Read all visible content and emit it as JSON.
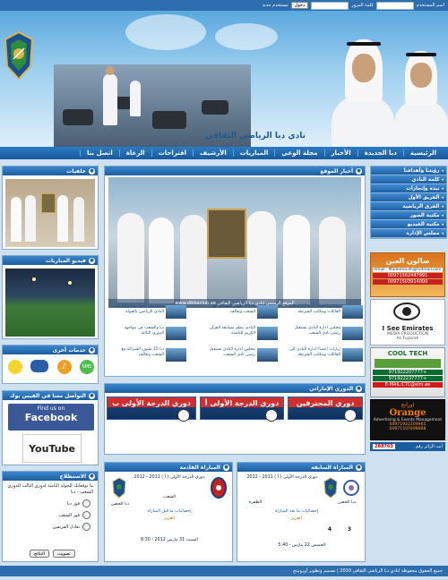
{
  "topbar": {
    "username_label": "اسم المستخدم",
    "password_label": "كلمة المرور",
    "login_button": "دخول",
    "register_link": "مستخدم جديد"
  },
  "header": {
    "site_title": "نادي دبا الرياضي الثقافي"
  },
  "mainnav": {
    "items": [
      "الرئيسية",
      "دبا الجديدة",
      "الأخبار",
      "مجلة الوعي",
      "المباريات",
      "الأرشيف",
      "اقتراحات",
      "الرعاة",
      "اتصل بنا"
    ]
  },
  "rightnav": {
    "items": [
      "رؤيتنا وأهدافنا",
      "كلمة النادي",
      "نبذة وإنجازات",
      "الفريق الأول",
      "الفرق الرياضية",
      "مكتبة الصور",
      "مكتبة الفيديو",
      "مجلس الإدارة"
    ]
  },
  "ads": {
    "ad1_title": "صالون العين",
    "ad1_email": "email : Madeena.eh@hotmail.com",
    "ad1_phone1": "00971562447991",
    "ad1_phone2": "00971503914000",
    "ad2_title": "I See Emirates",
    "ad2_sub": "MEDIA PRODUCTION",
    "ad2_city": "AL Fujairah",
    "ad3_title": "COOL TECH",
    "ad3_phone1": "+971922207777",
    "ad3_phone2": "+971922237777",
    "ad3_email": "E-MAIL:CTC@elm.ae",
    "ad4_arabic": "اورانج",
    "ad4_title": "Orange",
    "ad4_sub": "Advertising & Events Management",
    "ad4_phone1": "00971922209965",
    "ad4_phone2": "00971507898888"
  },
  "visitors": {
    "label": "أنت الزائر رقم",
    "count": "288763"
  },
  "panels": {
    "backgrounds_title": "خلفيات",
    "stadium_title": "فيديو المباريات",
    "services_title": "خدمات أخرى",
    "social_title": "التواصل معنا في الفيس بوك",
    "facebook_find": "Find us on",
    "facebook_name": "Facebook",
    "youtube_name": "YouTube",
    "poll_title": "الاستطلاع",
    "poll_question": "ما توقعاتك للجولة الثامنة لدوري الثالث للدوري الشعب - دبا",
    "poll_options": [
      "فوز دبا",
      "فوز الشعب",
      "تعادل الفريقين"
    ],
    "poll_vote": "تصويت",
    "poll_results": "النتائج",
    "news_title": "أخبار الموقع",
    "photo_caption": "الموقع الرسمي لنادي دبا الرياضي الثقافي   www.dibbaclub.ae",
    "league_title": "الدوري الإماراتي",
    "next_match_title": "المباراة القادمة",
    "prev_match_title": "المباراة السابقة"
  },
  "news": [
    "زيارات أعضاء ادارة النادي الى العائلات ومكاتب الشرطة",
    "دبا 15 مليون الشراكة مع الشعب وتعالف",
    "سمو ولي العهد ينوه بإنجازات النادي الرياضي بالجولة",
    "مجلس ادارة النادي يستقبل رئيس نادي الشعب",
    "النادي ينظم مسابقة القرآن الكريم للناشئة",
    "دبا والشعب في مواجهة الدوري الثالثة"
  ],
  "leagues": [
    "دوري المحترفين",
    "دوري الدرجة الأولى أ",
    "دوري الدرجة الأولى ب"
  ],
  "next_match": {
    "league": "دوري الدرجة الأولى ( أ ) 2011 - 2012",
    "home": "الشعب",
    "away": "دبا الحصن",
    "stats_link": "إحصائيات ما قبل المباراة",
    "venue": "العزيز",
    "date": "السبت 31 مارس 2012 - 8:30"
  },
  "prev_match": {
    "league": "دوري الدرجة الأولى ( أ ) 2011 - 2012",
    "home": "الظفرة",
    "away": "دبا الحصن",
    "stats_link": "إحصائيات ما بعد المباراة",
    "venue": "العزيز",
    "home_score": "3",
    "away_score": "4",
    "date": "الخميس 22 مارس - 5:40"
  },
  "footer": {
    "text": "جميع الحقوق محفوظة لنادي دبا الرياضي الثقافي 2010 | تصميم وتطوير أوروبيتج"
  },
  "colors": {
    "primary": "#2d6fae",
    "nav_dark": "#1c5d9f",
    "accent_red": "#d02f2f",
    "league_dark": "#102f5c"
  }
}
